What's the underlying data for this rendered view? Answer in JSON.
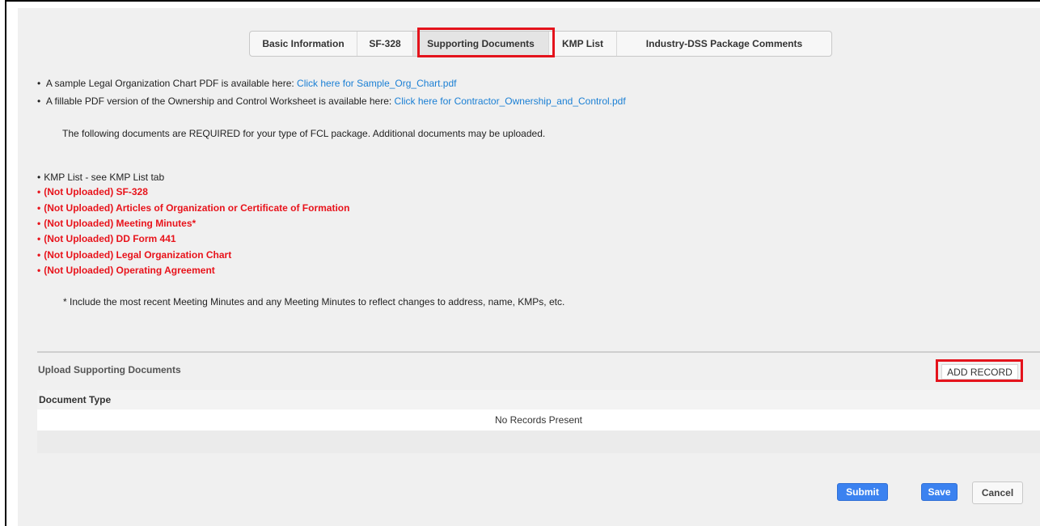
{
  "tabs": [
    {
      "label": "Basic Information",
      "active": false
    },
    {
      "label": "SF-328",
      "active": false
    },
    {
      "label": "Supporting Documents",
      "active": true
    },
    {
      "label": "KMP List",
      "active": false
    },
    {
      "label": "Industry-DSS Package Comments",
      "active": false
    }
  ],
  "info": {
    "sample_prefix": "A sample Legal Organization Chart PDF is available here: ",
    "sample_link": "Click here for Sample_Org_Chart.pdf",
    "worksheet_prefix": "A fillable PDF version of the Ownership and Control Worksheet is available here: ",
    "worksheet_link": "Click here for Contractor_Ownership_and_Control.pdf",
    "required_note": "The following documents are REQUIRED for your type of FCL package. Additional documents may be uploaded."
  },
  "required_docs": {
    "kmp": "KMP List - see KMP List tab",
    "missing": [
      "(Not Uploaded) SF-328",
      "(Not Uploaded) Articles of Organization or Certificate of Formation",
      "(Not Uploaded) Meeting Minutes*",
      "(Not Uploaded) DD Form 441",
      "(Not Uploaded) Legal Organization Chart",
      "(Not Uploaded) Operating Agreement"
    ]
  },
  "footnote": "* Include the most recent Meeting Minutes and any Meeting Minutes to reflect changes to address, name, KMPs, etc.",
  "upload": {
    "title": "Upload Supporting Documents",
    "add_label": "ADD RECORD",
    "column": "Document Type",
    "empty": "No Records Present"
  },
  "actions": {
    "submit": "Submit",
    "save": "Save",
    "cancel": "Cancel"
  },
  "colors": {
    "link": "#1a7fd4",
    "missing": "#e8131b",
    "primary_button": "#3b82f0",
    "highlight": "#e4131c"
  }
}
